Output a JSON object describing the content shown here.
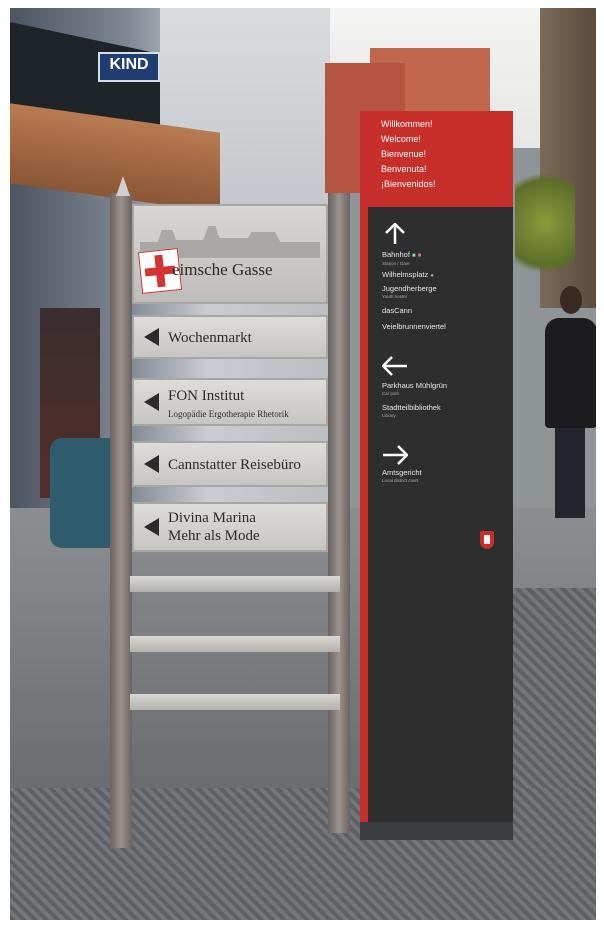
{
  "scene": {
    "shop_sign": "KIND",
    "old_signpost": {
      "top_plate": "eimsche Gasse",
      "sticker": "CCP",
      "plates": [
        {
          "lines": [
            "Wochenmarkt"
          ]
        },
        {
          "lines": [
            "FON Institut",
            "Logopädie Ergotherapie Rhetorik"
          ]
        },
        {
          "lines": [
            "Cannstatter Reisebüro"
          ]
        },
        {
          "lines": [
            "Divina Marina",
            "Mehr als Mode"
          ]
        }
      ]
    },
    "pylon": {
      "accent_color": "#c62f2a",
      "greetings": [
        "Willkommen!",
        "Welcome!",
        "Bienvenue!",
        "Benvenuta!",
        "¡Bienvenidos!"
      ],
      "groups": [
        {
          "arrow": "up-arrow-icon",
          "entries": [
            {
              "name": "Bahnhof",
              "sub": "Station / Gare"
            },
            {
              "name": "Wilhelmsplatz",
              "sub": ""
            },
            {
              "name": "Jugendherberge",
              "sub": "Youth hostel"
            },
            {
              "name": "dasCann",
              "sub": ""
            },
            {
              "name": "Veielbrunnenviertel",
              "sub": ""
            }
          ]
        },
        {
          "arrow": "left-arrow-icon",
          "entries": [
            {
              "name": "Parkhaus Mühlgrün",
              "sub": "Car park"
            },
            {
              "name": "Stadtteilbibliothek",
              "sub": "Library"
            }
          ]
        },
        {
          "arrow": "right-arrow-icon",
          "entries": [
            {
              "name": "Amtsgericht",
              "sub": "Local district court"
            }
          ]
        }
      ]
    }
  }
}
